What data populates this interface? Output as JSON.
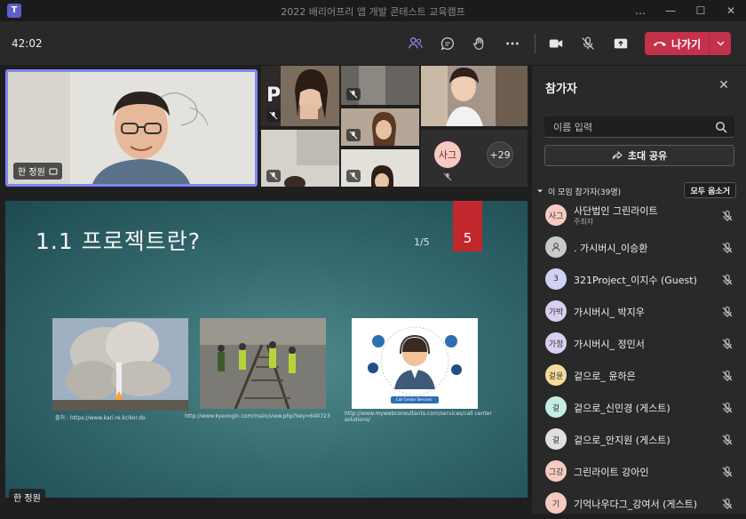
{
  "window": {
    "title": "2022 배리어프리 앱 개발 콘테스트 교육캠프",
    "controls": [
      "…",
      "—",
      "☐",
      "✕"
    ]
  },
  "toolbar": {
    "timer": "42:02",
    "leave_label": "나가기",
    "icons": [
      "people-icon",
      "chat-icon",
      "raise-hand-icon",
      "more-icon",
      "camera-icon",
      "mic-off-icon",
      "share-icon"
    ]
  },
  "stage": {
    "main_speaker_name": "한 정원",
    "overflow_count": "+29",
    "small_avatar_initials": "사그",
    "presenter_name": "한 정원"
  },
  "slide": {
    "title": "1.1 프로젝트란?",
    "page": "1/5",
    "number": "5",
    "captions": [
      "출처 : https://www.kari.re.kr/kor.do",
      "http://www.kyeongin.com/main/view.php?key=640723",
      "http://www.mywebconsultants.com/services/call center solutions/"
    ],
    "callcenter_label": "Call Center Services"
  },
  "panel": {
    "title": "참가자",
    "search_placeholder": "이름 입력",
    "invite_label": "초대 공유",
    "section_label": "이 모임 참가자(39명)",
    "mute_all_label": "모두 음소거",
    "participants": [
      {
        "initials": "사그",
        "name": "사단법인 그린라이트",
        "role": "주최자",
        "color": "#f6c9c3"
      },
      {
        "initials": "",
        "name": ". 가시버시_이승환",
        "role": "",
        "color": "#c9c9c9"
      },
      {
        "initials": "3",
        "name": "321Project_이지수 (Guest)",
        "role": "",
        "color": "#cfd2f2"
      },
      {
        "initials": "가박",
        "name": "가시버시_ 박지우",
        "role": "",
        "color": "#d8d0ee"
      },
      {
        "initials": "가정",
        "name": "가시버시_ 정민서",
        "role": "",
        "color": "#d8d0ee"
      },
      {
        "initials": "겉윤",
        "name": "겉으로_ 윤하은",
        "role": "",
        "color": "#f5dc9a"
      },
      {
        "initials": "겉",
        "name": "겉으로_신민경 (게스트)",
        "role": "",
        "color": "#c5ece5"
      },
      {
        "initials": "겉",
        "name": "겉으로_안지원 (게스트)",
        "role": "",
        "color": "#e0e0e0"
      },
      {
        "initials": "그강",
        "name": "그린라이트 강아인",
        "role": "",
        "color": "#f6c9c3"
      },
      {
        "initials": "기",
        "name": "기억나우다그_강여서 (게스트)",
        "role": "",
        "color": "#f6c9c3"
      }
    ]
  }
}
